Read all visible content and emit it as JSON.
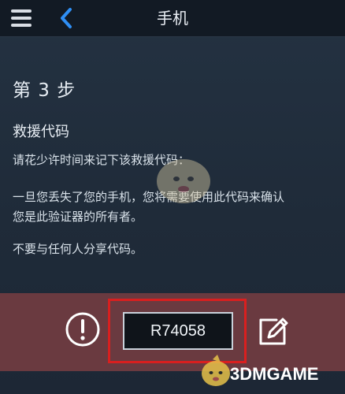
{
  "header": {
    "title": "手机",
    "menu_icon": "hamburger-menu-icon",
    "back_icon": "chevron-left-icon"
  },
  "content": {
    "step": "第 3 步",
    "section_title": "救援代码",
    "line1": "请花少许时间来记下该救援代码：",
    "line2a": "一旦您丢失了您的手机，您将需要使用此代码来确认",
    "line2b": "您是此验证器的所有者。",
    "line3": "不要与任何人分享代码。"
  },
  "bottom": {
    "code": "R74058",
    "alert_icon": "alert-circle-icon",
    "edit_icon": "edit-icon"
  },
  "watermark": {
    "text": "3DMGAME"
  },
  "colors": {
    "header_bg": "#121a24",
    "page_bg": "#243242",
    "bottom_bg": "#6a3a40",
    "code_bg": "#0f141a",
    "highlight": "#d91f1f",
    "accent_blue": "#2f8ff5"
  }
}
